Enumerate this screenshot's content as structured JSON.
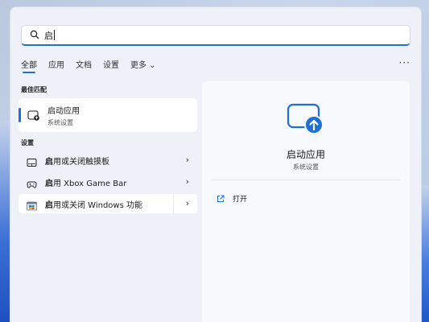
{
  "search": {
    "query": "启"
  },
  "tabs": [
    {
      "label": "全部",
      "active": true
    },
    {
      "label": "应用"
    },
    {
      "label": "文档"
    },
    {
      "label": "设置"
    },
    {
      "label": "更多 ⌄"
    }
  ],
  "more_options": "···",
  "best_match": {
    "section": "最佳匹配",
    "title": "启动应用",
    "subtitle": "系统设置",
    "icon": "startup-apps-icon"
  },
  "settings": {
    "section": "设置",
    "items": [
      {
        "bold": "启",
        "rest": "用或关闭触摸板",
        "icon": "touchpad-icon"
      },
      {
        "bold": "启",
        "rest": "用 Xbox Game Bar",
        "icon": "game-controller-icon"
      },
      {
        "bold": "启",
        "rest": "用或关闭 Windows 功能",
        "icon": "windows-features-icon"
      }
    ]
  },
  "detail": {
    "title": "启动应用",
    "subtitle": "系统设置",
    "open_label": "打开"
  },
  "colors": {
    "accent": "#1f6fd4",
    "panel": "#eef2f8"
  }
}
